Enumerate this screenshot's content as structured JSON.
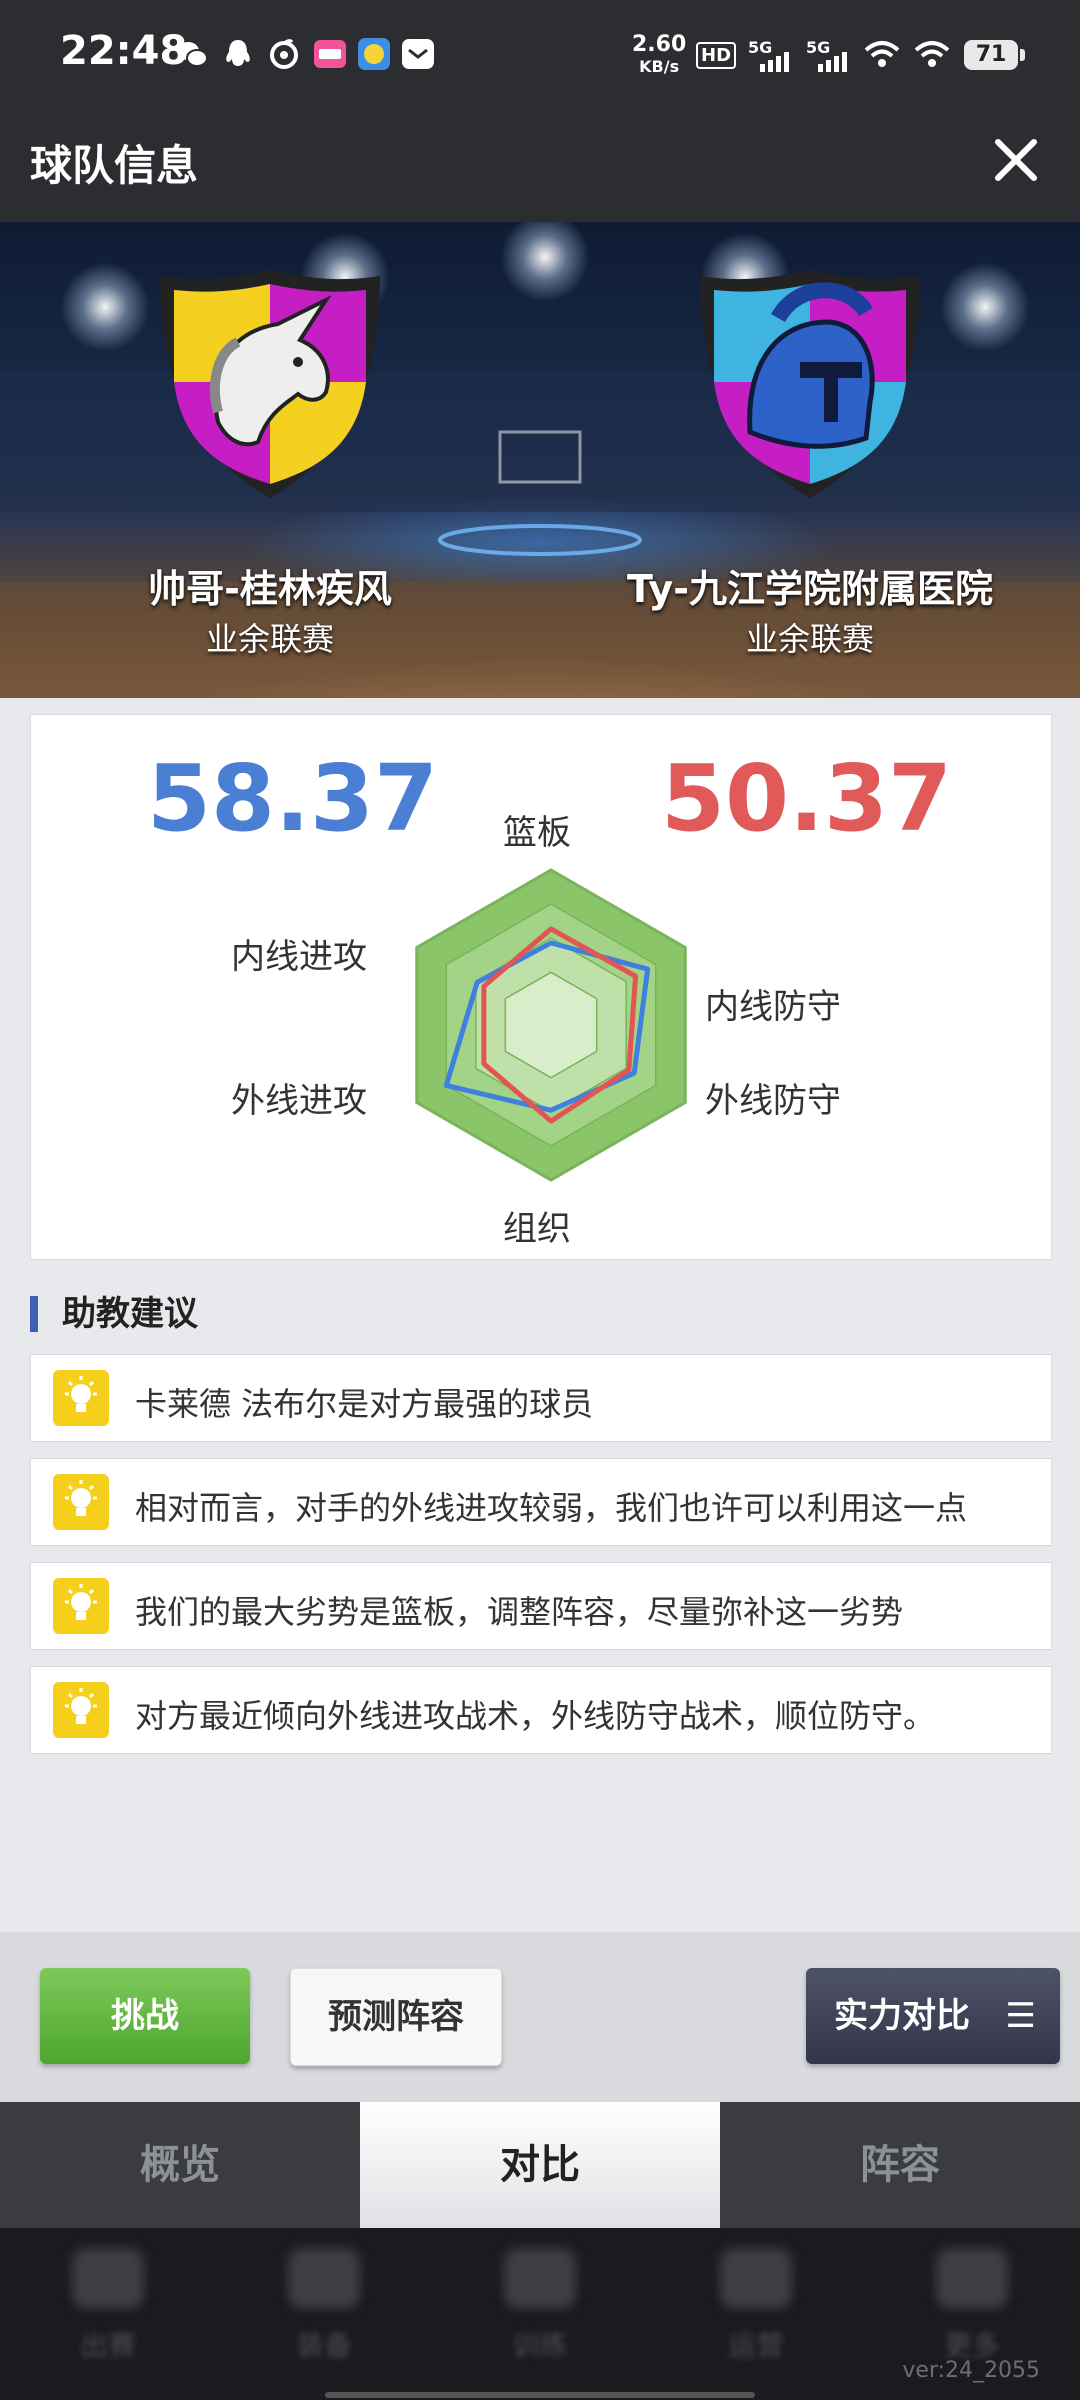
{
  "status_bar": {
    "time": "22:48",
    "net_speed_value": "2.60",
    "net_speed_unit": "KB/s",
    "hd_label": "HD",
    "sim1": "5G",
    "sim2": "5G",
    "battery": "71",
    "icons": [
      "wechat-icon",
      "qq-icon",
      "netease-music-icon",
      "bilibili-icon",
      "app-icon",
      "mail-icon",
      "hd-icon",
      "signal-icon",
      "wifi-icon",
      "battery-icon"
    ]
  },
  "header": {
    "title": "球队信息",
    "close_icon": "close-icon"
  },
  "teams": {
    "home": {
      "name": "帅哥-桂林疾风",
      "league": "业余联赛"
    },
    "away": {
      "name": "Ty-九江学院附属医院",
      "league": "业余联赛"
    }
  },
  "comparison": {
    "home_score": "58.37",
    "away_score": "50.37",
    "home_color": "#4a7fd4",
    "away_color": "#e05a5a",
    "axes": [
      "篮板",
      "内线防守",
      "外线防守",
      "组织",
      "外线进攻",
      "内线进攻"
    ],
    "chart_data": {
      "type": "radar",
      "axes": [
        "篮板",
        "内线防守",
        "外线防守",
        "组织",
        "外线进攻",
        "内线进攻"
      ],
      "range": [
        0,
        1
      ],
      "series": [
        {
          "color": "#3f7fe0",
          "values": [
            0.53,
            0.72,
            0.62,
            0.55,
            0.78,
            0.55
          ]
        },
        {
          "color": "#e25555",
          "values": [
            0.62,
            0.63,
            0.58,
            0.62,
            0.5,
            0.5
          ]
        }
      ]
    }
  },
  "advice": {
    "title": "助教建议",
    "items": [
      "卡莱德 法布尔是对方最强的球员",
      "相对而言，对手的外线进攻较弱，我们也许可以利用这一点",
      "我们的最大劣势是篮板，调整阵容，尽量弥补这一劣势",
      "对方最近倾向外线进攻战术，外线防守战术，顺位防守。"
    ]
  },
  "actions": {
    "challenge": "挑战",
    "predict": "预测阵容",
    "strength": "实力对比"
  },
  "tabs": [
    {
      "label": "概览"
    },
    {
      "label": "对比"
    },
    {
      "label": "阵容"
    }
  ],
  "active_tab": "对比",
  "bottom_nav": [
    "出赛",
    "装备",
    "训练",
    "运营",
    "更多"
  ],
  "version": "ver:24_2055"
}
